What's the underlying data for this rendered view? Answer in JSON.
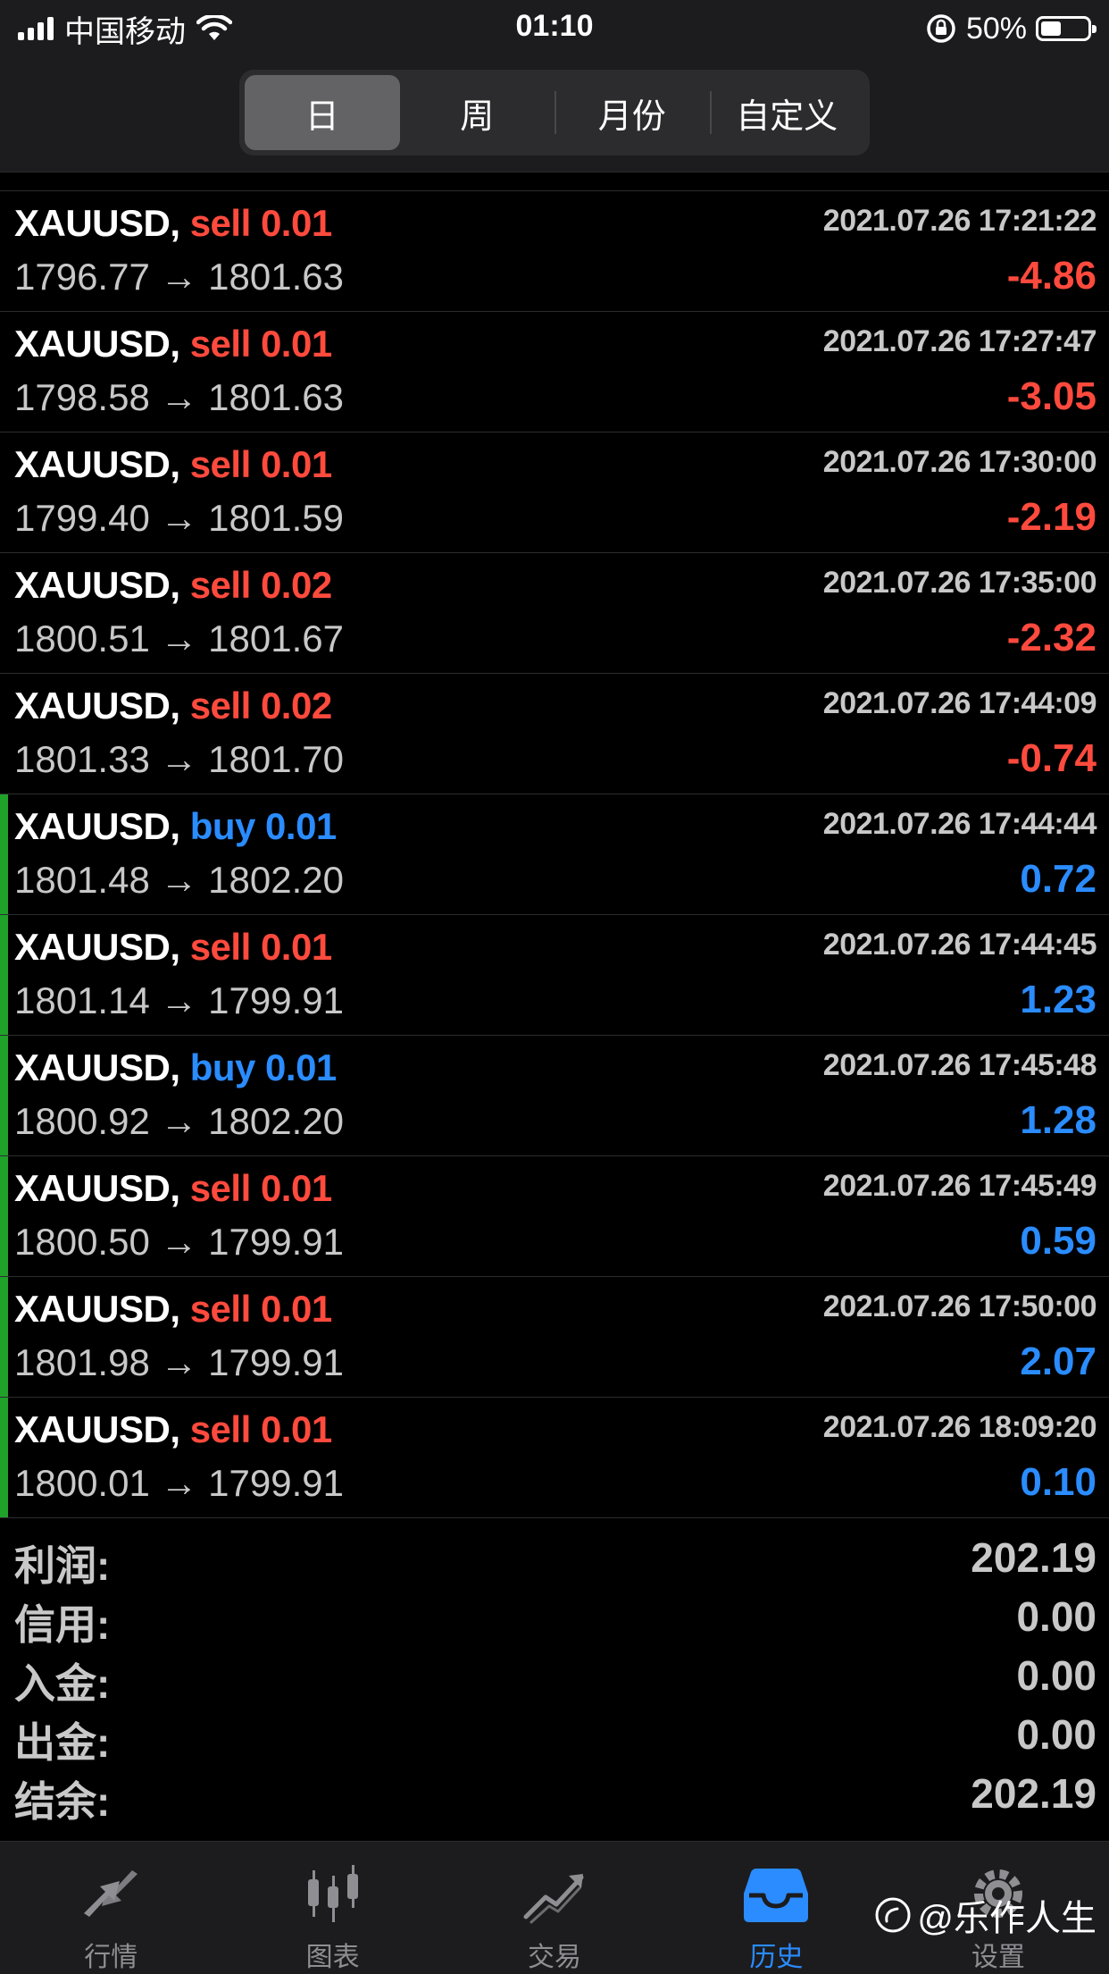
{
  "status_bar": {
    "carrier": "中国移动",
    "time": "01:10",
    "battery": "50%"
  },
  "segments": [
    {
      "label": "日",
      "active": true
    },
    {
      "label": "周",
      "active": false
    },
    {
      "label": "月份",
      "active": false
    },
    {
      "label": "自定义",
      "active": false
    }
  ],
  "deals": [
    {
      "symbol": "XAUUSD,",
      "side": "sell",
      "volume": "0.01",
      "time": "2021.07.26 17:21:22",
      "open": "1796.77",
      "close": "1801.63",
      "profit": "-4.86"
    },
    {
      "symbol": "XAUUSD,",
      "side": "sell",
      "volume": "0.01",
      "time": "2021.07.26 17:27:47",
      "open": "1798.58",
      "close": "1801.63",
      "profit": "-3.05"
    },
    {
      "symbol": "XAUUSD,",
      "side": "sell",
      "volume": "0.01",
      "time": "2021.07.26 17:30:00",
      "open": "1799.40",
      "close": "1801.59",
      "profit": "-2.19"
    },
    {
      "symbol": "XAUUSD,",
      "side": "sell",
      "volume": "0.02",
      "time": "2021.07.26 17:35:00",
      "open": "1800.51",
      "close": "1801.67",
      "profit": "-2.32"
    },
    {
      "symbol": "XAUUSD,",
      "side": "sell",
      "volume": "0.02",
      "time": "2021.07.26 17:44:09",
      "open": "1801.33",
      "close": "1801.70",
      "profit": "-0.74"
    },
    {
      "symbol": "XAUUSD,",
      "side": "buy",
      "volume": "0.01",
      "time": "2021.07.26 17:44:44",
      "open": "1801.48",
      "close": "1802.20",
      "profit": "0.72"
    },
    {
      "symbol": "XAUUSD,",
      "side": "sell",
      "volume": "0.01",
      "time": "2021.07.26 17:44:45",
      "open": "1801.14",
      "close": "1799.91",
      "profit": "1.23"
    },
    {
      "symbol": "XAUUSD,",
      "side": "buy",
      "volume": "0.01",
      "time": "2021.07.26 17:45:48",
      "open": "1800.92",
      "close": "1802.20",
      "profit": "1.28"
    },
    {
      "symbol": "XAUUSD,",
      "side": "sell",
      "volume": "0.01",
      "time": "2021.07.26 17:45:49",
      "open": "1800.50",
      "close": "1799.91",
      "profit": "0.59"
    },
    {
      "symbol": "XAUUSD,",
      "side": "sell",
      "volume": "0.01",
      "time": "2021.07.26 17:50:00",
      "open": "1801.98",
      "close": "1799.91",
      "profit": "2.07"
    },
    {
      "symbol": "XAUUSD,",
      "side": "sell",
      "volume": "0.01",
      "time": "2021.07.26 18:09:20",
      "open": "1800.01",
      "close": "1799.91",
      "profit": "0.10"
    }
  ],
  "summary": [
    {
      "label": "利润:",
      "value": "202.19"
    },
    {
      "label": "信用:",
      "value": "0.00"
    },
    {
      "label": "入金:",
      "value": "0.00"
    },
    {
      "label": "出金:",
      "value": "0.00"
    },
    {
      "label": "结余:",
      "value": "202.19"
    }
  ],
  "tabs": [
    {
      "label": "行情",
      "icon": "quotes-icon",
      "active": false
    },
    {
      "label": "图表",
      "icon": "candlestick-chart-icon",
      "active": false
    },
    {
      "label": "交易",
      "icon": "trade-chart-icon",
      "active": false
    },
    {
      "label": "历史",
      "icon": "history-inbox-icon",
      "active": true
    },
    {
      "label": "设置",
      "icon": "gear-icon",
      "active": false
    }
  ],
  "watermark": "@乐作人生",
  "colors": {
    "sell": "#ff4a3d",
    "buy": "#2a8cff",
    "loss": "#ff4a3d",
    "gain": "#2a8cff",
    "win_marker": "#1fa12a",
    "active_tab": "#2a8cff"
  }
}
